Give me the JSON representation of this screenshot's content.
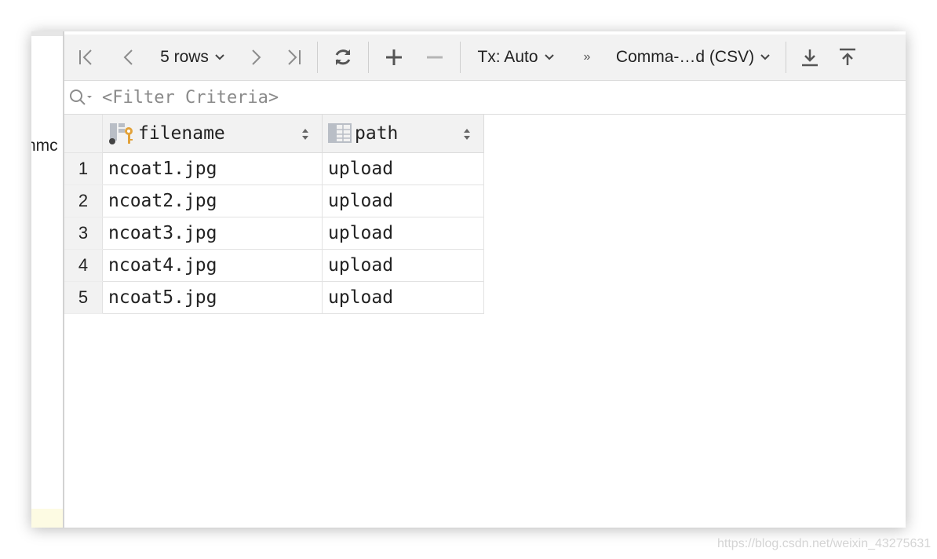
{
  "left_panel": {
    "partial_text": "nmc"
  },
  "toolbar": {
    "first_icon": "first-page-icon",
    "prev_icon": "previous-page-icon",
    "rows_label": "5 rows",
    "next_icon": "next-page-icon",
    "last_icon": "last-page-icon",
    "refresh_icon": "refresh-icon",
    "add_icon": "add-row-icon",
    "remove_icon": "remove-row-icon",
    "tx_label": "Tx: Auto",
    "more_label": "»",
    "format_label": "Comma-…d (CSV)",
    "download_icon": "export-icon",
    "upload_icon": "import-icon"
  },
  "filter": {
    "placeholder": "<Filter Criteria>"
  },
  "table": {
    "columns": [
      {
        "label": "filename",
        "icon": "primary-key-column-icon"
      },
      {
        "label": "path",
        "icon": "column-icon"
      }
    ],
    "rows": [
      {
        "num": "1",
        "filename": "ncoat1.jpg",
        "path": "upload"
      },
      {
        "num": "2",
        "filename": "ncoat2.jpg",
        "path": "upload"
      },
      {
        "num": "3",
        "filename": "ncoat3.jpg",
        "path": "upload"
      },
      {
        "num": "4",
        "filename": "ncoat4.jpg",
        "path": "upload"
      },
      {
        "num": "5",
        "filename": "ncoat5.jpg",
        "path": "upload"
      }
    ]
  },
  "watermark": "https://blog.csdn.net/weixin_43275631",
  "colors": {
    "toolbar_bg": "#f2f2f2",
    "border": "#dcdcdc",
    "key_icon": "#e2a23a"
  }
}
